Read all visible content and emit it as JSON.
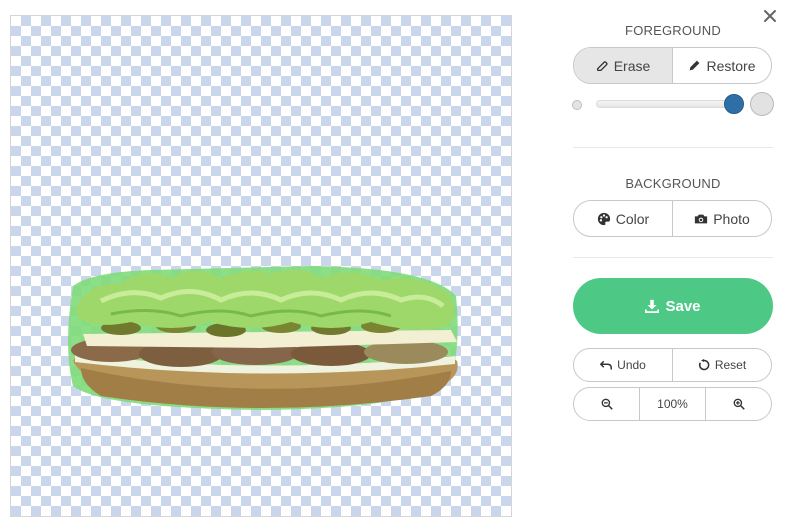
{
  "window": {
    "close_label": "×"
  },
  "canvas": {
    "background": "transparency-checkerboard",
    "image_subject": "sandwich-cutout"
  },
  "foreground": {
    "heading": "FOREGROUND",
    "erase_label": "Erase",
    "restore_label": "Restore",
    "active_mode": "erase",
    "brush_size_fraction": 0.95
  },
  "background": {
    "heading": "BACKGROUND",
    "color_label": "Color",
    "photo_label": "Photo"
  },
  "actions": {
    "save_label": "Save",
    "undo_label": "Undo",
    "reset_label": "Reset"
  },
  "zoom": {
    "level": "100%"
  },
  "colors": {
    "accent_green": "#4dc985",
    "slider_thumb": "#2f6fa7",
    "checker": "#c9d6ec"
  },
  "icons": {
    "erase": "eraser-icon",
    "restore": "pencil-icon",
    "color": "palette-icon",
    "photo": "camera-icon",
    "save": "download-icon",
    "undo": "undo-icon",
    "reset": "reset-icon",
    "zoom_out": "zoom-out-icon",
    "zoom_in": "zoom-in-icon"
  }
}
